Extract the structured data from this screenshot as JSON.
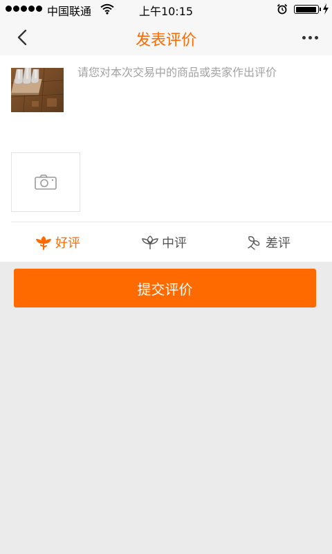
{
  "status_bar": {
    "carrier": "中国联通",
    "time": "上午10:15"
  },
  "nav": {
    "title": "发表评价",
    "back_icon": "back-chevron-icon",
    "more_icon": "more-dots-icon"
  },
  "review": {
    "placeholder": "请您对本次交易中的商品或卖家作出评价",
    "photo_icon": "camera-icon"
  },
  "ratings": {
    "good_label": "好评",
    "mid_label": "中评",
    "bad_label": "差评",
    "selected": "good"
  },
  "submit_label": "提交评价",
  "colors": {
    "accent": "#ff6a00",
    "background": "#ebebeb",
    "placeholder": "#a3a3a3"
  }
}
